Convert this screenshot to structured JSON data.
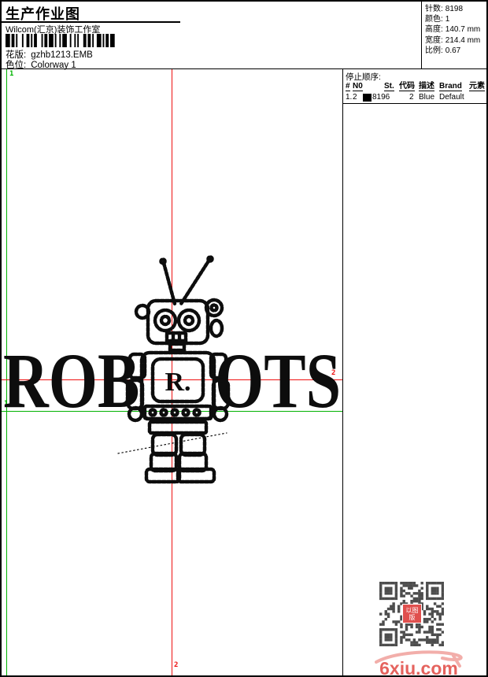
{
  "page": {
    "title": "生产作业图",
    "company": "Wilcom(汇京)装饰工作室",
    "pattern_label": "花版:",
    "pattern_value": "gzhb1213.EMB",
    "colorway_label": "色位:",
    "colorway_value": "Colorway 1"
  },
  "stats": {
    "rows": [
      {
        "label": "针数:",
        "value": "8198"
      },
      {
        "label": "颜色:",
        "value": "1"
      },
      {
        "label": "高度:",
        "value": "140.7 mm"
      },
      {
        "label": "宽度:",
        "value": "214.4 mm"
      },
      {
        "label": "比例:",
        "value": "0.67"
      }
    ]
  },
  "stop_sequence": {
    "title": "停止顺序:",
    "columns": [
      "#",
      "N0",
      "St.",
      "代码",
      "描述",
      "Brand",
      "元素"
    ],
    "rows": [
      {
        "num": "1.",
        "n0": "2",
        "st": "8196",
        "code": "2",
        "desc": "Blue",
        "brand": "Default",
        "element": "",
        "swatch_color": "#000000"
      }
    ]
  },
  "design": {
    "word_left": "ROB",
    "word_right": "OTS",
    "chest_letter": "R.",
    "start_marker": "1",
    "end_marker": "2",
    "start_color": "#00b300",
    "end_color": "#ee1111"
  },
  "footer": {
    "watermark": "6xiu.com",
    "watermark_color": "#e5635e",
    "qr_logo_text": "以图版"
  }
}
